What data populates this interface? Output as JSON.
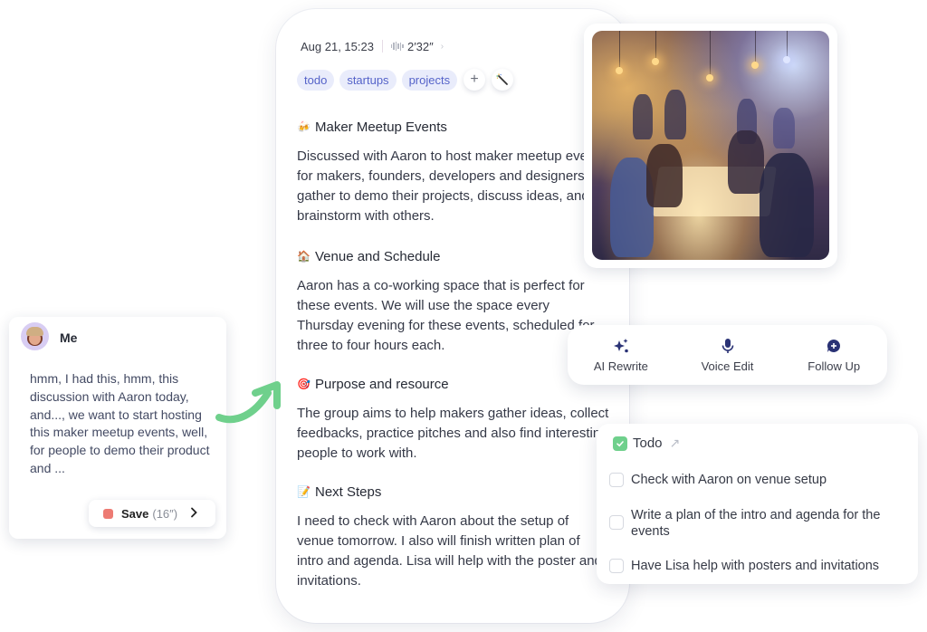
{
  "note": {
    "timestamp": "Aug 21, 15:23",
    "duration": "2′32″",
    "duration_chevron": "›",
    "tags": [
      "todo",
      "startups",
      "projects"
    ],
    "add_tag_label": "+",
    "sections": [
      {
        "emoji": "🍻",
        "icon": "beer-mugs-icon",
        "title": "Maker Meetup Events",
        "body": "Discussed with Aaron to host maker meetup events for makers, founders, developers and designers to gather to demo their projects, discuss ideas, and brainstorm with others."
      },
      {
        "emoji": "🏠",
        "icon": "house-icon",
        "title": "Venue and Schedule",
        "body": "Aaron has a co-working space that is perfect for these events. We will use the space every Thursday evening for these events, scheduled for three to four hours each."
      },
      {
        "emoji": "🎯",
        "icon": "target-icon",
        "title": "Purpose and resource",
        "body": "The group aims to help makers gather ideas, collect feedbacks, practice pitches and also find interesting people to work with."
      },
      {
        "emoji": "📝",
        "icon": "memo-icon",
        "title": "Next Steps",
        "body": "I need to check with Aaron about the setup of venue tomorrow. I also will finish written plan of intro and agenda. Lisa will help with the poster and invitations."
      }
    ]
  },
  "image": {
    "alt": "Illustration of a maker meetup with people gathered around tables under warm hanging lamps"
  },
  "actions": [
    {
      "label": "AI Rewrite",
      "icon": "sparkles-icon"
    },
    {
      "label": "Voice Edit",
      "icon": "microphone-icon"
    },
    {
      "label": "Follow Up",
      "icon": "chat-plus-icon"
    }
  ],
  "todo": {
    "title": "Todo",
    "items": [
      {
        "text": "Check with Aaron on venue setup",
        "checked": false
      },
      {
        "text": "Write a plan of the intro and agenda for the events",
        "checked": false
      },
      {
        "text": "Have Lisa help with posters and invitations",
        "checked": false
      }
    ]
  },
  "memo": {
    "speaker": "Me",
    "transcript": "hmm, I had this, hmm, this discussion with Aaron today, and..., we want to start hosting this maker meetup events, well, for people to demo their product and ...",
    "save_label": "Save",
    "save_duration": "(16″)"
  },
  "colors": {
    "tag_bg": "#e9ecfb",
    "tag_text": "#5563c9",
    "accent_navy": "#2a3275",
    "todo_green": "#6fd08c",
    "record_red": "#ed7b73",
    "arrow_green": "#6fd08c"
  }
}
